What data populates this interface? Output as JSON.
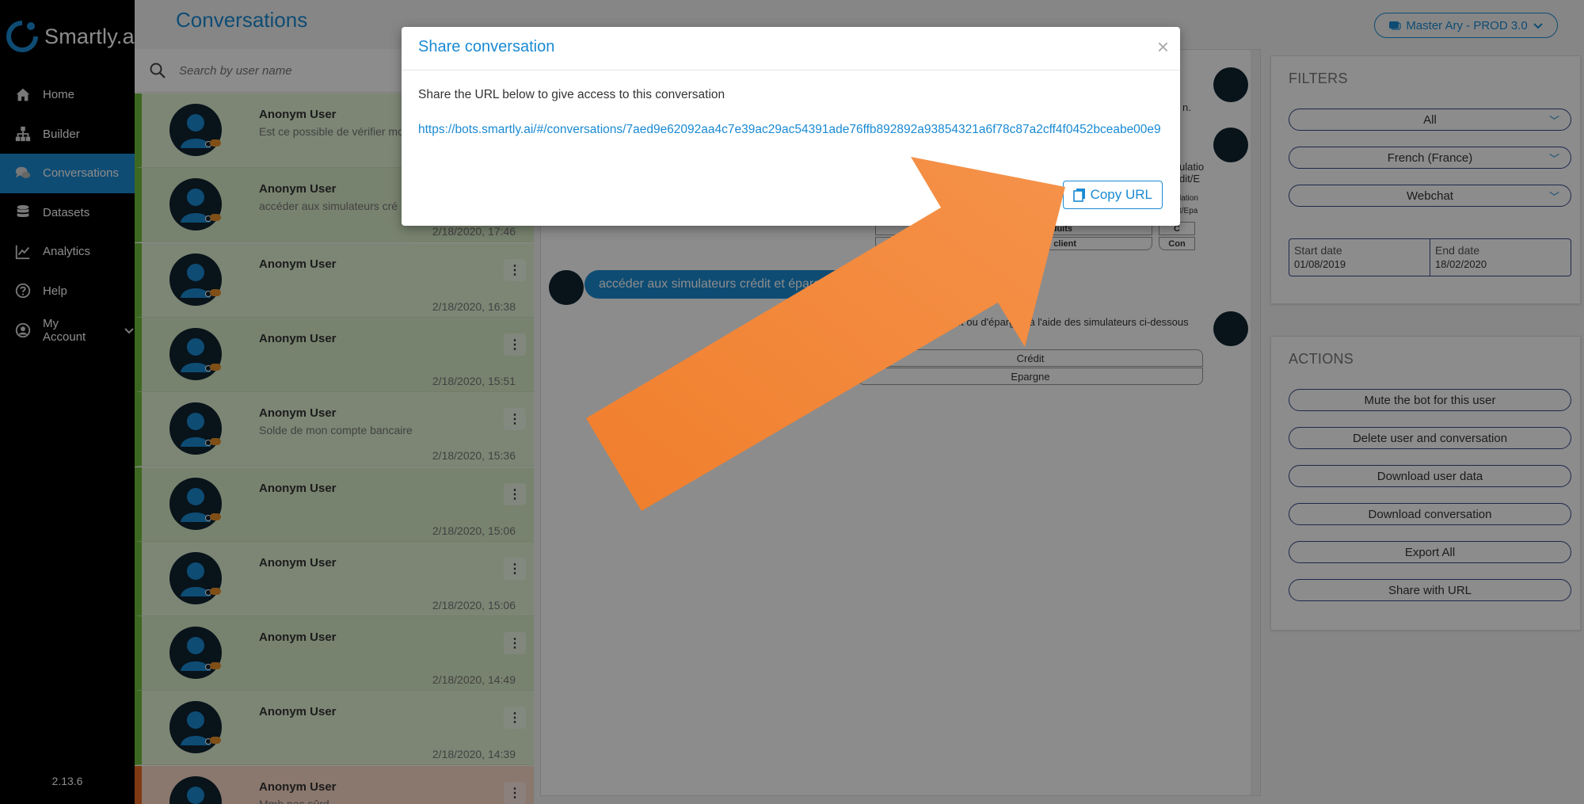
{
  "brand": {
    "name": "Smartly.ai",
    "accent": "#1a8ad3"
  },
  "sidebar": {
    "items": [
      {
        "label": "Home",
        "icon": "home-icon"
      },
      {
        "label": "Builder",
        "icon": "sitemap-icon"
      },
      {
        "label": "Conversations",
        "icon": "chat-icon",
        "active": true
      },
      {
        "label": "Datasets",
        "icon": "database-icon"
      },
      {
        "label": "Analytics",
        "icon": "chart-line-icon"
      },
      {
        "label": "Help",
        "icon": "help-icon"
      },
      {
        "label": "My Account",
        "icon": "user-circle-icon"
      }
    ],
    "version": "2.13.6"
  },
  "header": {
    "title": "Conversations",
    "bot_selector": "Master Ary - PROD 3.0"
  },
  "search": {
    "placeholder": "Search by user name"
  },
  "conversations": [
    {
      "name": "Anonym User",
      "message": "Est ce possible de vérifier mo",
      "date": ""
    },
    {
      "name": "Anonym User",
      "message": "accéder aux simulateurs cré",
      "date": "2/18/2020, 17:46"
    },
    {
      "name": "Anonym User",
      "message": "",
      "date": "2/18/2020, 16:38"
    },
    {
      "name": "Anonym User",
      "message": "",
      "date": "2/18/2020, 15:51"
    },
    {
      "name": "Anonym User",
      "message": "Solde de mon compte bancaire",
      "date": "2/18/2020, 15:36"
    },
    {
      "name": "Anonym User",
      "message": "",
      "date": "2/18/2020, 15:06"
    },
    {
      "name": "Anonym User",
      "message": "",
      "date": "2/18/2020, 15:06"
    },
    {
      "name": "Anonym User",
      "message": "",
      "date": "2/18/2020, 14:49"
    },
    {
      "name": "Anonym User",
      "message": "",
      "date": "2/18/2020, 14:39"
    },
    {
      "name": "Anonym User",
      "message": "Mmh pas sûrd",
      "date": ""
    }
  ],
  "chat": {
    "bot_snippet_1": "n.",
    "card_text_1": "ulatio",
    "card_text_2": "dit/E",
    "card_text_3": "lation",
    "card_text_4": "t/Epa",
    "buttons_row1": [
      "voir les produits",
      "C"
    ],
    "buttons_row2": [
      "Devenir client",
      "Con"
    ],
    "user_message": "accéder aux simulateurs crédit et épargne",
    "bot_reply": "dit ou d'épargne à l'aide des simulateurs ci-dessous",
    "reply_buttons": [
      "Crédit",
      "Epargne"
    ]
  },
  "filters": {
    "title": "FILTERS",
    "channel_all": "All",
    "language": "French (France)",
    "platform": "Webchat",
    "start_label": "Start date",
    "start_value": "01/08/2019",
    "end_label": "End date",
    "end_value": "18/02/2020"
  },
  "actions": {
    "title": "ACTIONS",
    "buttons": [
      "Mute the bot for this user",
      "Delete user and conversation",
      "Download user data",
      "Download conversation",
      "Export All",
      "Share with URL"
    ]
  },
  "modal": {
    "title": "Share conversation",
    "close": "×",
    "description": "Share the URL below to give access to this conversation",
    "url": "https://bots.smartly.ai/#/conversations/7aed9e62092aa4c7e39ac29ac54391ade76ffb892892a93854321a6f78c87a2cff4f0452bceabe00e9",
    "copy_label": "Copy URL"
  },
  "annotation": {
    "arrow_color": "#ef7d2c"
  }
}
